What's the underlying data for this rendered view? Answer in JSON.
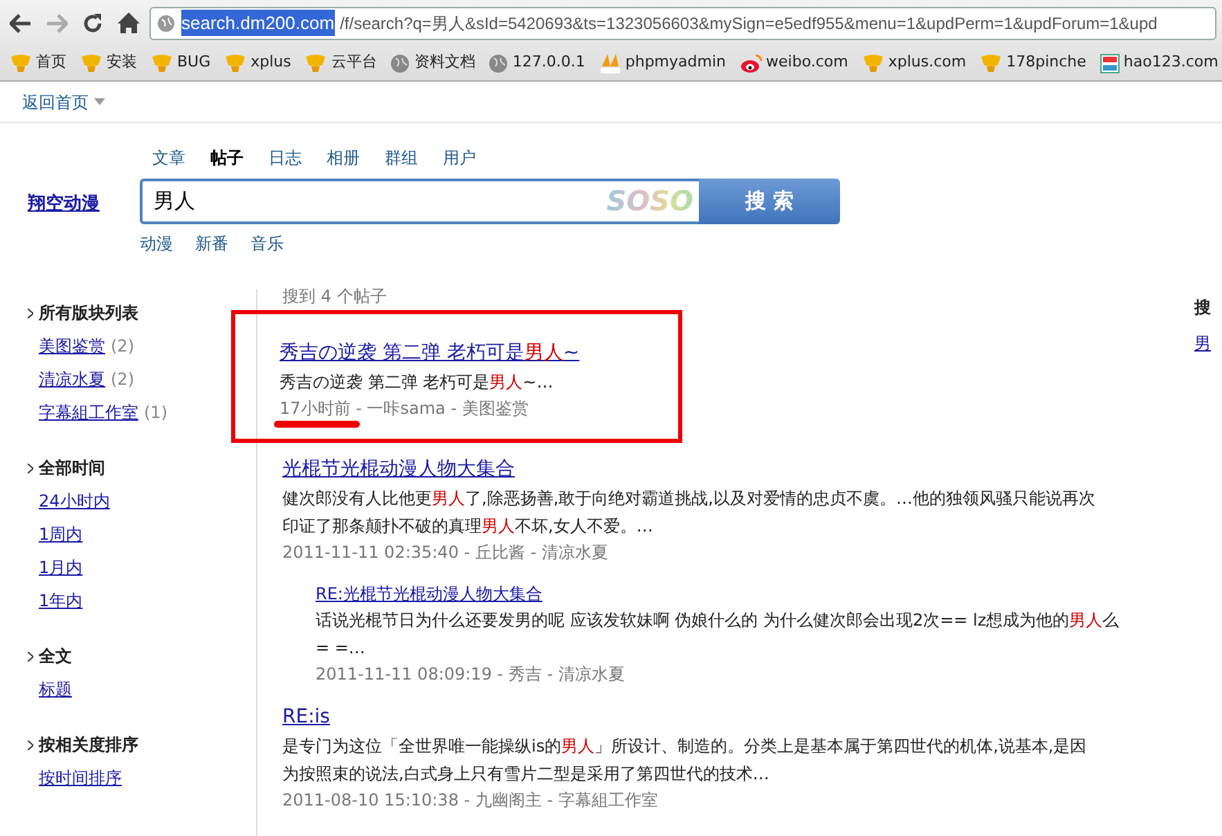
{
  "browser": {
    "address": {
      "host": "search.dm200.com",
      "host_selected": true,
      "path": "/f/search?q=男人&sId=5420693&ts=1323056603&mySign=e5edf955&menu=1&updPerm=1&updForum=1&upd"
    },
    "bookmarks": [
      {
        "label": "首页",
        "kind": "cup"
      },
      {
        "label": "安装",
        "kind": "cup"
      },
      {
        "label": "BUG",
        "kind": "cup"
      },
      {
        "label": "xplus",
        "kind": "cup"
      },
      {
        "label": "云平台",
        "kind": "cup"
      },
      {
        "label": "资料文档",
        "kind": "globe"
      },
      {
        "label": "127.0.0.1",
        "kind": "globe"
      },
      {
        "label": "phpmyadmin",
        "kind": "pma"
      },
      {
        "label": "weibo.com",
        "kind": "weibo"
      },
      {
        "label": "xplus.com",
        "kind": "cup"
      },
      {
        "label": "178pinche",
        "kind": "cup"
      },
      {
        "label": "hao123.com",
        "kind": "hao"
      }
    ]
  },
  "topbar": {
    "back_home": "返回首页"
  },
  "search": {
    "site": "翔空动漫",
    "tabs": [
      {
        "label": "文章",
        "selected": false
      },
      {
        "label": "帖子",
        "selected": true
      },
      {
        "label": "日志",
        "selected": false
      },
      {
        "label": "相册",
        "selected": false
      },
      {
        "label": "群组",
        "selected": false
      },
      {
        "label": "用户",
        "selected": false
      }
    ],
    "value": "男人",
    "brand": "SOSO",
    "button": "搜 索",
    "categories": [
      "动漫",
      "新番",
      "音乐"
    ]
  },
  "sidebar": [
    {
      "title": "所有版块列表",
      "items": [
        {
          "label": "美图鉴赏",
          "count": "(2)"
        },
        {
          "label": "清凉水夏",
          "count": "(2)"
        },
        {
          "label": "字幕組工作室",
          "count": "(1)"
        }
      ]
    },
    {
      "title": "全部时间",
      "items": [
        {
          "label": "24小时内"
        },
        {
          "label": "1周内"
        },
        {
          "label": "1月内"
        },
        {
          "label": "1年内"
        }
      ]
    },
    {
      "title": "全文",
      "items": [
        {
          "label": "标题"
        }
      ]
    },
    {
      "title": "按相关度排序",
      "items": [
        {
          "label": "按时间排序"
        }
      ]
    }
  ],
  "summary": "搜到 4 个帖子",
  "results": [
    {
      "reply": false,
      "annotated": true,
      "title": [
        {
          "text": "秀吉の逆袭 第二弹 老朽可是",
          "hit": false
        },
        {
          "text": "男人",
          "hit": true
        },
        {
          "text": "~",
          "hit": false
        }
      ],
      "snippet": [
        {
          "text": "秀吉の逆袭 第二弹 老朽可是",
          "hit": false
        },
        {
          "text": "男人",
          "hit": true
        },
        {
          "text": "~…",
          "hit": false
        }
      ],
      "meta": "17小时前 - 一咔sama - 美图鉴赏"
    },
    {
      "reply": false,
      "annotated": false,
      "title": [
        {
          "text": "光棍节光棍动漫人物大集合",
          "hit": false
        }
      ],
      "snippet": [
        {
          "text": "健次郎没有人比他更",
          "hit": false
        },
        {
          "text": "男人",
          "hit": true
        },
        {
          "text": "了,除恶扬善,敢于向绝对霸道挑战,以及对爱情的忠贞不虞。…他的独领风骚只能说再次印证了那条颠扑不破的真理",
          "hit": false
        },
        {
          "text": "男人",
          "hit": true
        },
        {
          "text": "不坏,女人不爱。…",
          "hit": false
        }
      ],
      "meta": "2011-11-11 02:35:40 - 丘比酱 - 清凉水夏"
    },
    {
      "reply": true,
      "annotated": false,
      "title": [
        {
          "text": "RE:光棍节光棍动漫人物大集合",
          "hit": false
        }
      ],
      "snippet": [
        {
          "text": "话说光棍节日为什么还要发男的呢 应该发软妹啊 伪娘什么的 为什么健次郎会出现2次== lz想成为他的",
          "hit": false
        },
        {
          "text": "男人",
          "hit": true
        },
        {
          "text": "么= =…",
          "hit": false
        }
      ],
      "meta": "2011-11-11 08:09:19 - 秀吉 - 清凉水夏"
    },
    {
      "reply": false,
      "annotated": false,
      "title": [
        {
          "text": "RE:is",
          "hit": false
        }
      ],
      "snippet": [
        {
          "text": "是专门为这位「全世界唯一能操纵is的",
          "hit": false
        },
        {
          "text": "男人",
          "hit": true
        },
        {
          "text": "」所设计、制造的。分类上是基本属于第四世代的机体,说基本,是因为按照束的说法,白式身上只有雪片二型是采用了第四世代的技术…",
          "hit": false
        }
      ],
      "meta": "2011-08-10 15:10:38 - 九幽阁主 - 字幕組工作室"
    }
  ],
  "right_panel": {
    "heading": "搜",
    "link": "男"
  }
}
